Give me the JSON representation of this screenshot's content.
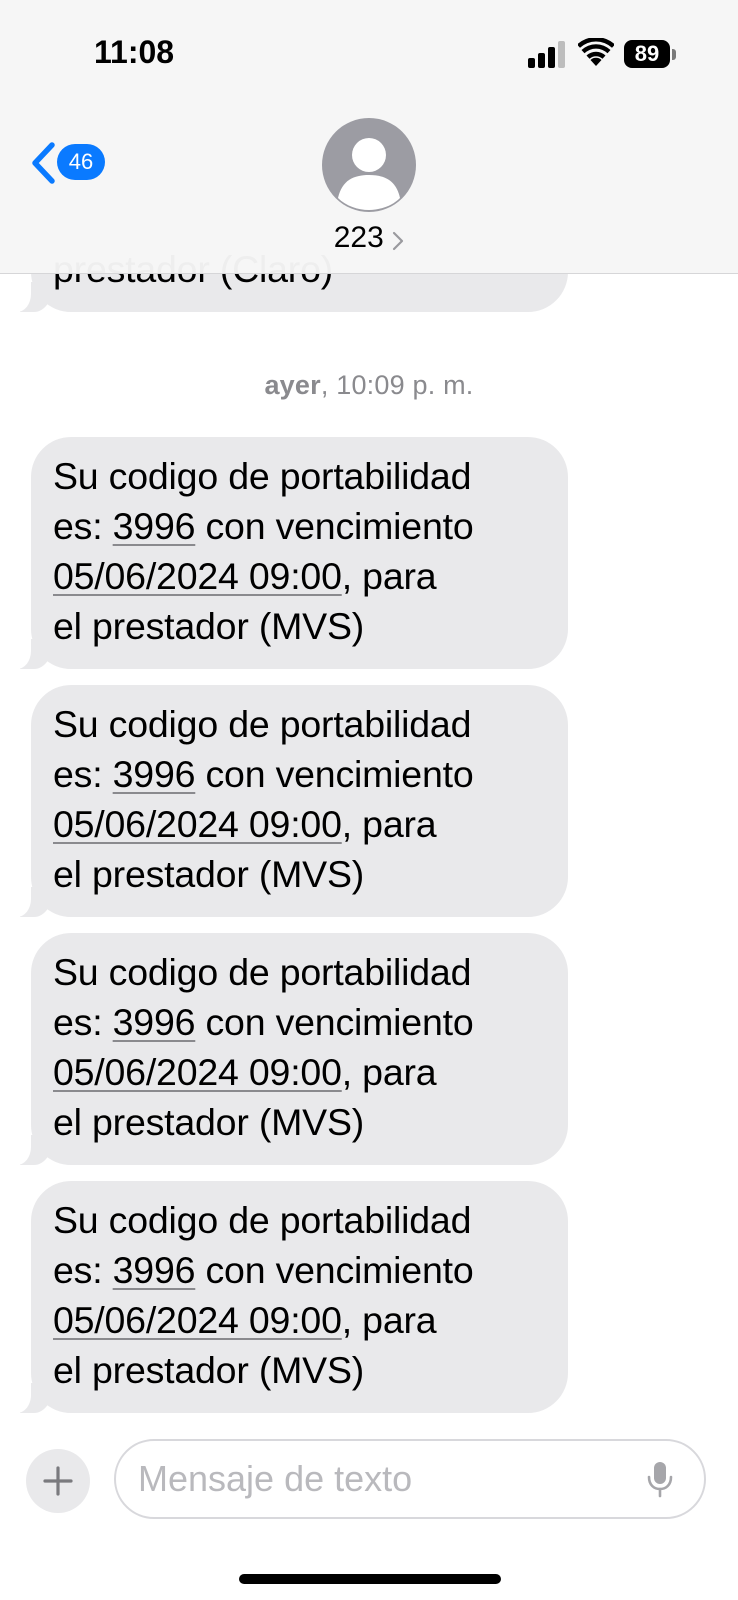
{
  "status_bar": {
    "time": "11:08",
    "battery_level": "89"
  },
  "header": {
    "unread_count": "46",
    "contact_name": "223"
  },
  "conversation": {
    "previous_message_fragment": "prestador (Claro)",
    "timestamp": {
      "day": "ayer",
      "time": ", 10:09 p. m."
    },
    "messages": [
      {
        "line1": "Su codigo de portabilidad",
        "es_prefix": "es: ",
        "code": "3996",
        "mid": " con vencimiento",
        "date": "05/06/2024 09:00",
        "after_date": ", para",
        "line4": "el prestador (MVS)"
      },
      {
        "line1": "Su codigo de portabilidad",
        "es_prefix": "es: ",
        "code": "3996",
        "mid": " con vencimiento",
        "date": "05/06/2024 09:00",
        "after_date": ", para",
        "line4": "el prestador (MVS)"
      },
      {
        "line1": "Su codigo de portabilidad",
        "es_prefix": "es: ",
        "code": "3996",
        "mid": " con vencimiento",
        "date": "05/06/2024 09:00",
        "after_date": ", para",
        "line4": "el prestador (MVS)"
      },
      {
        "line1": "Su codigo de portabilidad",
        "es_prefix": "es: ",
        "code": "3996",
        "mid": " con vencimiento",
        "date": "05/06/2024 09:00",
        "after_date": ", para",
        "line4": "el prestador (MVS)"
      }
    ]
  },
  "input_bar": {
    "placeholder": "Mensaje de texto",
    "value": ""
  }
}
